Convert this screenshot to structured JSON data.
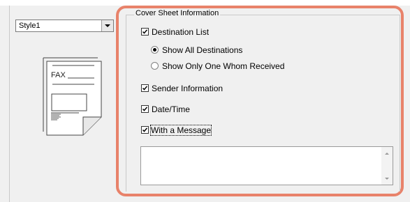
{
  "style_select": {
    "value": "Style1"
  },
  "illustration": {
    "fax_text": "FAX"
  },
  "group": {
    "title": "Cover Sheet Information",
    "destination_list": {
      "label": "Destination List",
      "checked": true
    },
    "show_all": {
      "label": "Show All Destinations",
      "selected": true
    },
    "show_one": {
      "label": "Show Only One Whom Received",
      "selected": false
    },
    "sender_info": {
      "label": "Sender Information",
      "checked": true
    },
    "date_time": {
      "label": "Date/Time",
      "checked": true
    },
    "with_message": {
      "label": "With a Message",
      "checked": true
    },
    "message_text": ""
  },
  "colors": {
    "highlight_frame": "#e8826a"
  }
}
